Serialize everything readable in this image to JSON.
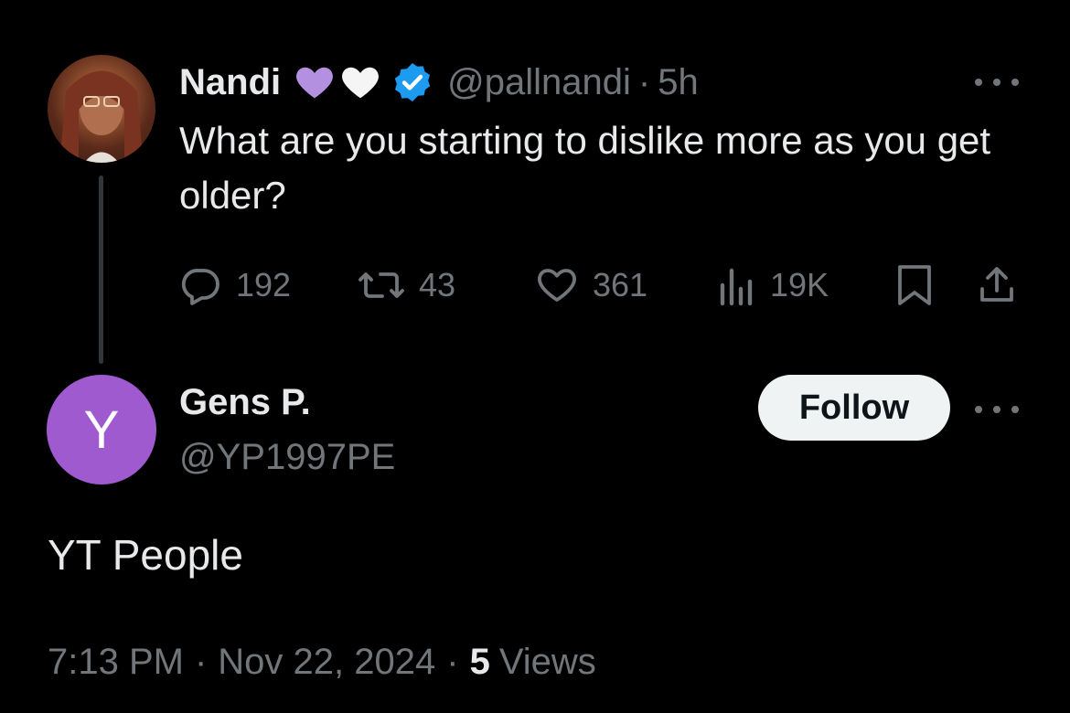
{
  "parent_tweet": {
    "display_name": "Nandi",
    "emoji": [
      "purple-heart",
      "white-heart"
    ],
    "verified": true,
    "handle": "@pallnandi",
    "separator": "·",
    "time_ago": "5h",
    "text": "What are you starting to dislike more as you get older?",
    "stats": {
      "replies": "192",
      "reposts": "43",
      "likes": "361",
      "views": "19K"
    },
    "icons": {
      "reply": "reply-icon",
      "repost": "repost-icon",
      "like": "heart-icon",
      "views": "analytics-icon",
      "bookmark": "bookmark-icon",
      "share": "share-icon",
      "more": "more-icon"
    }
  },
  "reply": {
    "avatar_letter": "Y",
    "display_name": "Gens P.",
    "handle": "@YP1997PE",
    "follow_label": "Follow",
    "text": "YT People",
    "time": "7:13 PM",
    "separator": "·",
    "date": "Nov 22, 2024",
    "views_count": "5",
    "views_label": "Views"
  },
  "colors": {
    "background": "#000000",
    "text_primary": "#e7e9ea",
    "text_secondary": "#71767b",
    "verified": "#1d9bf0",
    "avatar_y": "#a05ad0",
    "follow_bg": "#eff3f4",
    "purple_heart": "#b491e0",
    "white_heart": "#f5f5f5"
  }
}
